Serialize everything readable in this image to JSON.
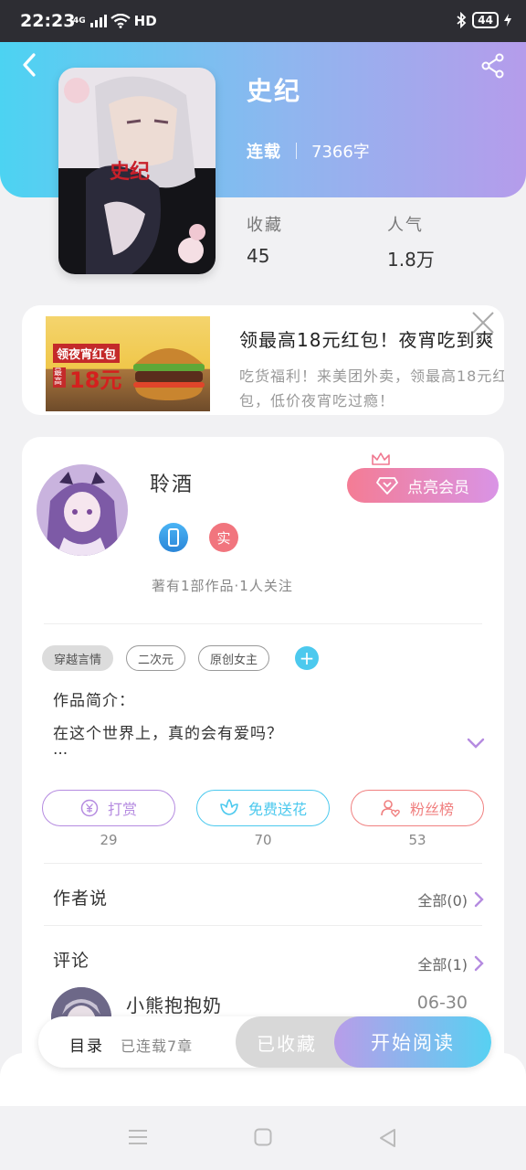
{
  "status_bar": {
    "time": "22:23",
    "network": "4G",
    "hd": "HD",
    "battery": "44"
  },
  "book": {
    "title": "史纪",
    "cover_title": "史纪",
    "status": "连载",
    "word_count": "7366字"
  },
  "stats": [
    {
      "label": "收藏",
      "value": "45"
    },
    {
      "label": "人气",
      "value": "1.8万"
    }
  ],
  "ad": {
    "title": "领最高18元红包！夜宵吃到爽",
    "desc": "吃货福利！来美团外卖，领最高18元红包，低价夜宵吃过瘾！",
    "img_top": "领夜宵红包",
    "img_amount": "18元",
    "img_prefix": "最高"
  },
  "author": {
    "name": "聆酒",
    "vip_button": "点亮会员",
    "badge_real": "实",
    "works": "著有1部作品·1人关注"
  },
  "tags": [
    "穿越言情",
    "二次元",
    "原创女主"
  ],
  "intro": {
    "heading": "作品简介：",
    "text": "在这个世界上，真的会有爱吗？",
    "more": "..."
  },
  "actions": [
    {
      "label": "打赏",
      "count": "29",
      "color": "#b58be0"
    },
    {
      "label": "免费送花",
      "count": "70",
      "color": "#4cc9ee"
    },
    {
      "label": "粉丝榜",
      "count": "53",
      "color": "#f08080"
    }
  ],
  "author_says": {
    "title": "作者说",
    "all": "全部(0)"
  },
  "comments": {
    "title": "评论",
    "all": "全部(1)",
    "first_user": "小熊抱抱奶",
    "first_date": "06-30"
  },
  "bottom": {
    "toc": "目录",
    "serial": "已连载7章",
    "collected": "已收藏",
    "read": "开始阅读"
  }
}
